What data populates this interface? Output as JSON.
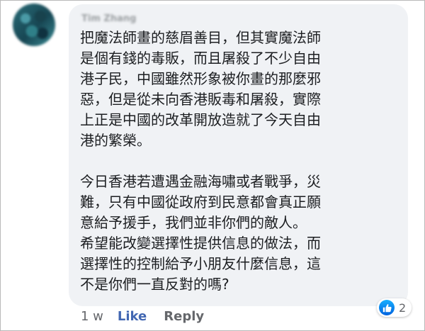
{
  "comment": {
    "author": "Tim Zhang",
    "lines": [
      "把魔法師畫的慈眉善目，但其實魔法師",
      "是個有錢的毒販，而且屠殺了不少自由",
      "港子民，中國雖然形象被你畫的那麼邪",
      "惡，但是從未向香港販毒和屠殺，實際",
      "上正是中國的改革開放造就了今天自由",
      "港的繁榮。",
      "",
      "今日香港若遭遇金融海嘯或者戰爭，災",
      "難，只有中國從政府到民意都會真正願",
      "意給予援手，我們並非你們的敵人。",
      "希望能改變選擇性提供信息的做法，而",
      "選擇性的控制給予小朋友什麼信息，這",
      "不是你們一直反對的嗎?"
    ],
    "timestamp": "1 w",
    "like_label": "Like",
    "reply_label": "Reply",
    "reaction_count": "2",
    "reaction_icon": "thumbs-up-icon",
    "colors": {
      "bubble": "#f0f2f5",
      "link": "#4267b2",
      "muted": "#65676b",
      "text": "#1c1e21",
      "like_badge": "#1877f2"
    }
  }
}
